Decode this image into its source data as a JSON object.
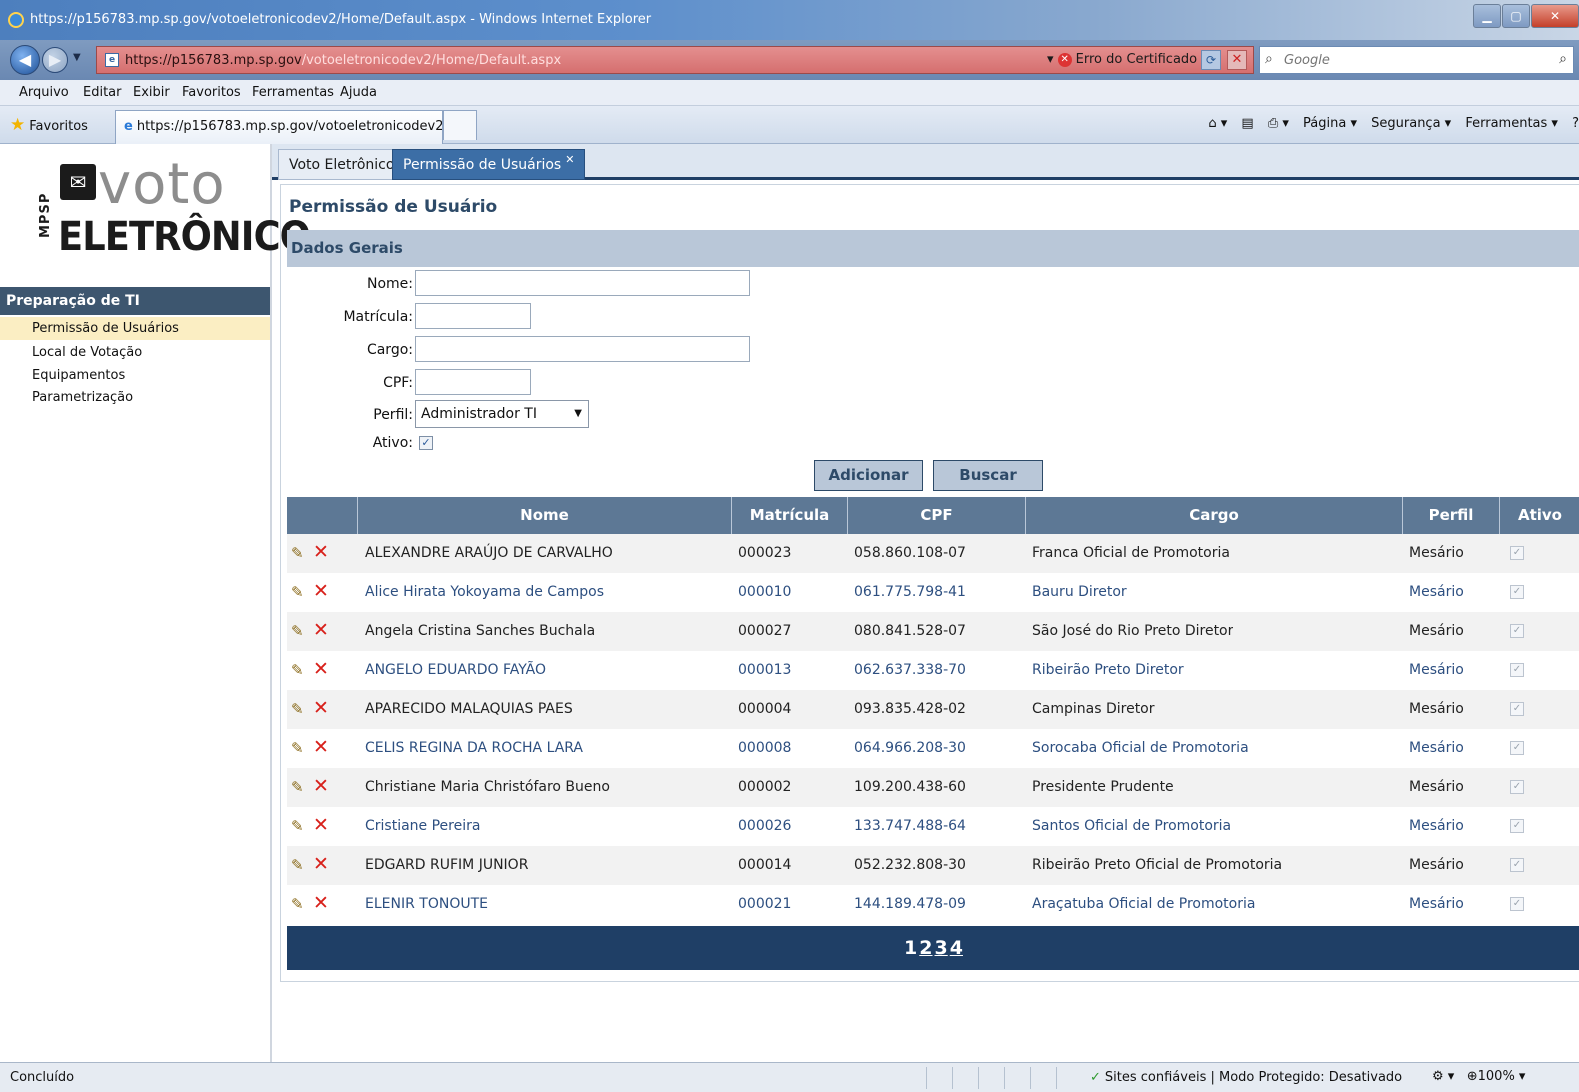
{
  "window": {
    "title": "https://p156783.mp.sp.gov/votoeletronicodev2/Home/Default.aspx - Windows Internet Explorer",
    "address_host": "https://p156783.mp.sp.gov",
    "address_path": "/votoeletronicodev2/Home/Default.aspx",
    "cert_error": "Erro do Certificado",
    "search_placeholder": "Google"
  },
  "menu": [
    "Arquivo",
    "Editar",
    "Exibir",
    "Favoritos",
    "Ferramentas",
    "Ajuda"
  ],
  "favbar": {
    "favorites_label": "Favoritos",
    "tab_title": "https://p156783.mp.sp.gov/votoeletronicodev2/...",
    "cmd_pagina": "Página ▾",
    "cmd_seguranca": "Segurança ▾",
    "cmd_ferramentas": "Ferramentas ▾"
  },
  "logo": {
    "org": "MPSP",
    "word1": "voto",
    "word2": "ELETRÔNICO"
  },
  "sidebar": {
    "header": "Preparação de TI",
    "items": [
      {
        "label": "Permissão de Usuários",
        "active": true
      },
      {
        "label": "Local de Votação",
        "active": false
      },
      {
        "label": "Equipamentos",
        "active": false
      },
      {
        "label": "Parametrização",
        "active": false
      }
    ]
  },
  "tabs": [
    {
      "label": "Voto Eletrônico"
    },
    {
      "label": "Permissão de Usuários"
    }
  ],
  "page": {
    "title": "Permissão de Usuário",
    "section": "Dados Gerais"
  },
  "form": {
    "nome_label": "Nome:",
    "matricula_label": "Matrícula:",
    "cargo_label": "Cargo:",
    "cpf_label": "CPF:",
    "perfil_label": "Perfil:",
    "perfil_value": "Administrador TI",
    "ativo_label": "Ativo:",
    "add_button": "Adicionar",
    "search_button": "Buscar"
  },
  "grid": {
    "columns": [
      "Nome",
      "Matrícula",
      "CPF",
      "Cargo",
      "Perfil",
      "Ativo"
    ],
    "rows": [
      {
        "nome": "ALEXANDRE ARAÚJO DE CARVALHO",
        "matricula": "000023",
        "cpf": "058.860.108-07",
        "cargo": "Franca Oficial de Promotoria",
        "perfil": "Mesário"
      },
      {
        "nome": "Alice Hirata Yokoyama de Campos",
        "matricula": "000010",
        "cpf": "061.775.798-41",
        "cargo": "Bauru Diretor",
        "perfil": "Mesário"
      },
      {
        "nome": "Angela Cristina Sanches Buchala",
        "matricula": "000027",
        "cpf": "080.841.528-07",
        "cargo": "São José do Rio Preto Diretor",
        "perfil": "Mesário"
      },
      {
        "nome": "ANGELO EDUARDO FAYÃO",
        "matricula": "000013",
        "cpf": "062.637.338-70",
        "cargo": "Ribeirão Preto Diretor",
        "perfil": "Mesário"
      },
      {
        "nome": "APARECIDO MALAQUIAS PAES",
        "matricula": "000004",
        "cpf": "093.835.428-02",
        "cargo": "Campinas Diretor",
        "perfil": "Mesário"
      },
      {
        "nome": "CELIS REGINA DA ROCHA LARA",
        "matricula": "000008",
        "cpf": "064.966.208-30",
        "cargo": "Sorocaba Oficial de Promotoria",
        "perfil": "Mesário"
      },
      {
        "nome": "Christiane Maria Christófaro Bueno",
        "matricula": "000002",
        "cpf": "109.200.438-60",
        "cargo": "Presidente Prudente",
        "perfil": "Mesário"
      },
      {
        "nome": "Cristiane Pereira",
        "matricula": "000026",
        "cpf": "133.747.488-64",
        "cargo": "Santos Oficial de Promotoria",
        "perfil": "Mesário"
      },
      {
        "nome": "EDGARD RUFIM JUNIOR",
        "matricula": "000014",
        "cpf": "052.232.808-30",
        "cargo": "Ribeirão Preto Oficial de Promotoria",
        "perfil": "Mesário"
      },
      {
        "nome": "ELENIR TONOUTE",
        "matricula": "000021",
        "cpf": "144.189.478-09",
        "cargo": "Araçatuba Oficial de Promotoria",
        "perfil": "Mesário"
      }
    ],
    "pages": [
      "1",
      "2",
      "3",
      "4"
    ]
  },
  "status": {
    "left": "Concluído",
    "zone": "Sites confiáveis | Modo Protegido: Desativado",
    "zoom": "100%"
  }
}
